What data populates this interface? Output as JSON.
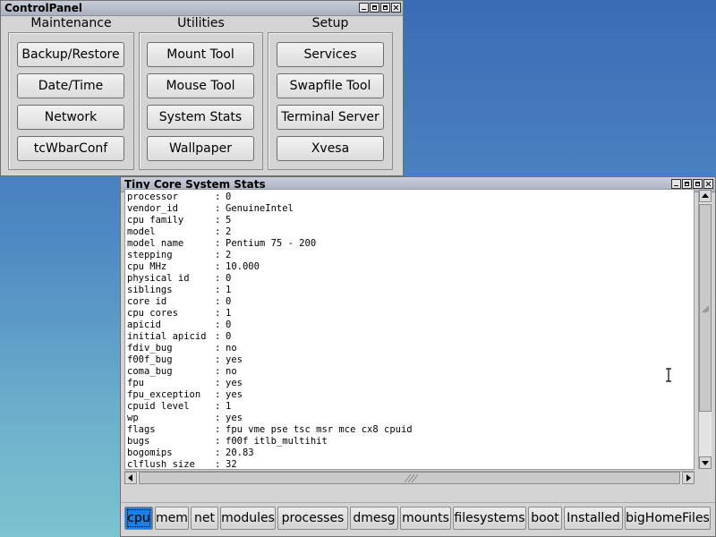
{
  "control_panel": {
    "title": "ControlPanel",
    "sections": [
      {
        "title": "Maintenance",
        "buttons": [
          "Backup/Restore",
          "Date/Time",
          "Network",
          "tcWbarConf"
        ]
      },
      {
        "title": "Utilities",
        "buttons": [
          "Mount Tool",
          "Mouse Tool",
          "System Stats",
          "Wallpaper"
        ]
      },
      {
        "title": "Setup",
        "buttons": [
          "Services",
          "Swapfile Tool",
          "Terminal Server",
          "Xvesa"
        ]
      }
    ]
  },
  "stats_window": {
    "title": "Tiny Core System Stats",
    "lines": [
      {
        "key": "processor",
        "value": "0"
      },
      {
        "key": "vendor_id",
        "value": "GenuineIntel"
      },
      {
        "key": "cpu family",
        "value": "5"
      },
      {
        "key": "model",
        "value": "2"
      },
      {
        "key": "model name",
        "value": "Pentium 75 - 200"
      },
      {
        "key": "stepping",
        "value": "2"
      },
      {
        "key": "cpu MHz",
        "value": "10.000"
      },
      {
        "key": "physical id",
        "value": "0"
      },
      {
        "key": "siblings",
        "value": "1"
      },
      {
        "key": "core id",
        "value": "0"
      },
      {
        "key": "cpu cores",
        "value": "1"
      },
      {
        "key": "apicid",
        "value": "0"
      },
      {
        "key": "initial apicid",
        "value": "0"
      },
      {
        "key": "fdiv_bug",
        "value": "no"
      },
      {
        "key": "f00f_bug",
        "value": "yes"
      },
      {
        "key": "coma_bug",
        "value": "no"
      },
      {
        "key": "fpu",
        "value": "yes"
      },
      {
        "key": "fpu_exception",
        "value": "yes"
      },
      {
        "key": "cpuid level",
        "value": "1"
      },
      {
        "key": "wp",
        "value": "yes"
      },
      {
        "key": "flags",
        "value": "fpu vme pse tsc msr mce cx8 cpuid"
      },
      {
        "key": "bugs",
        "value": "f00f itlb_multihit"
      },
      {
        "key": "bogomips",
        "value": "20.83"
      },
      {
        "key": "clflush size",
        "value": "32"
      }
    ],
    "separator": ":",
    "tabs": [
      "cpu",
      "mem",
      "net",
      "modules",
      "processes",
      "dmesg",
      "mounts",
      "filesystems",
      "boot",
      "Installed",
      "bigHomeFiles"
    ],
    "active_tab": "cpu"
  },
  "colors": {
    "desktop_top": "#3a6cb6",
    "desktop_bottom": "#7cc2cf",
    "active_tab": "#1e7fe0",
    "window_bg": "#d4d4d4"
  }
}
